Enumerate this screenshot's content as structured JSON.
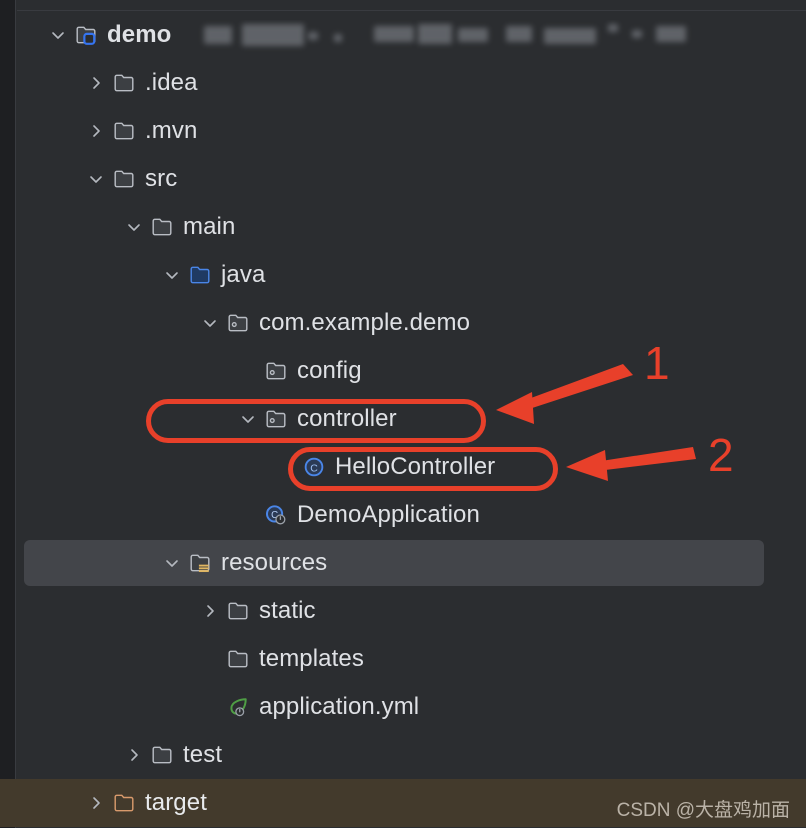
{
  "panel": {
    "name": "project-tree",
    "background_color": "#2b2d30",
    "gutter_color": "#1e1f22",
    "selection_color": "#43454a",
    "target_row_color": "#433a2c"
  },
  "annotations": {
    "color": "#e8402a",
    "marker_1": "1",
    "marker_2": "2",
    "box_1_target": "controller",
    "box_2_target": "HelloController"
  },
  "watermark": {
    "text": "CSDN @大盘鸡加面"
  },
  "redacted_label": "blurred-path-text",
  "tree": {
    "items": [
      {
        "label": "demo",
        "icon": "module-folder-icon",
        "twisty": "chevron-down-icon",
        "depth": 0,
        "bold": true,
        "selected": false
      },
      {
        "label": ".idea",
        "icon": "folder-icon",
        "twisty": "chevron-right-icon",
        "depth": 1,
        "bold": false,
        "selected": false
      },
      {
        "label": ".mvn",
        "icon": "folder-icon",
        "twisty": "chevron-right-icon",
        "depth": 1,
        "bold": false,
        "selected": false
      },
      {
        "label": "src",
        "icon": "folder-icon",
        "twisty": "chevron-down-icon",
        "depth": 1,
        "bold": false,
        "selected": false
      },
      {
        "label": "main",
        "icon": "folder-icon",
        "twisty": "chevron-down-icon",
        "depth": 2,
        "bold": false,
        "selected": false
      },
      {
        "label": "java",
        "icon": "source-root-folder-icon",
        "twisty": "chevron-down-icon",
        "depth": 3,
        "bold": false,
        "selected": false
      },
      {
        "label": "com.example.demo",
        "icon": "package-icon",
        "twisty": "chevron-down-icon",
        "depth": 4,
        "bold": false,
        "selected": false
      },
      {
        "label": "config",
        "icon": "package-icon",
        "twisty": "none",
        "depth": 5,
        "bold": false,
        "selected": false
      },
      {
        "label": "controller",
        "icon": "package-icon",
        "twisty": "chevron-down-icon",
        "depth": 5,
        "bold": false,
        "selected": false
      },
      {
        "label": "HelloController",
        "icon": "java-class-icon",
        "twisty": "none",
        "depth": 6,
        "bold": false,
        "selected": false
      },
      {
        "label": "DemoApplication",
        "icon": "spring-boot-class-icon",
        "twisty": "none",
        "depth": 5,
        "bold": false,
        "selected": false
      },
      {
        "label": "resources",
        "icon": "resources-folder-icon",
        "twisty": "chevron-down-icon",
        "depth": 3,
        "bold": false,
        "selected": true
      },
      {
        "label": "static",
        "icon": "folder-icon",
        "twisty": "chevron-right-icon",
        "depth": 4,
        "bold": false,
        "selected": false
      },
      {
        "label": "templates",
        "icon": "folder-icon",
        "twisty": "none",
        "depth": 4,
        "bold": false,
        "selected": false
      },
      {
        "label": "application.yml",
        "icon": "spring-yaml-icon",
        "twisty": "none",
        "depth": 4,
        "bold": false,
        "selected": false
      },
      {
        "label": "test",
        "icon": "folder-icon",
        "twisty": "chevron-right-icon",
        "depth": 2,
        "bold": false,
        "selected": false
      },
      {
        "label": "target",
        "icon": "excluded-folder-icon",
        "twisty": "chevron-right-icon",
        "depth": 1,
        "bold": false,
        "selected": false
      }
    ]
  }
}
